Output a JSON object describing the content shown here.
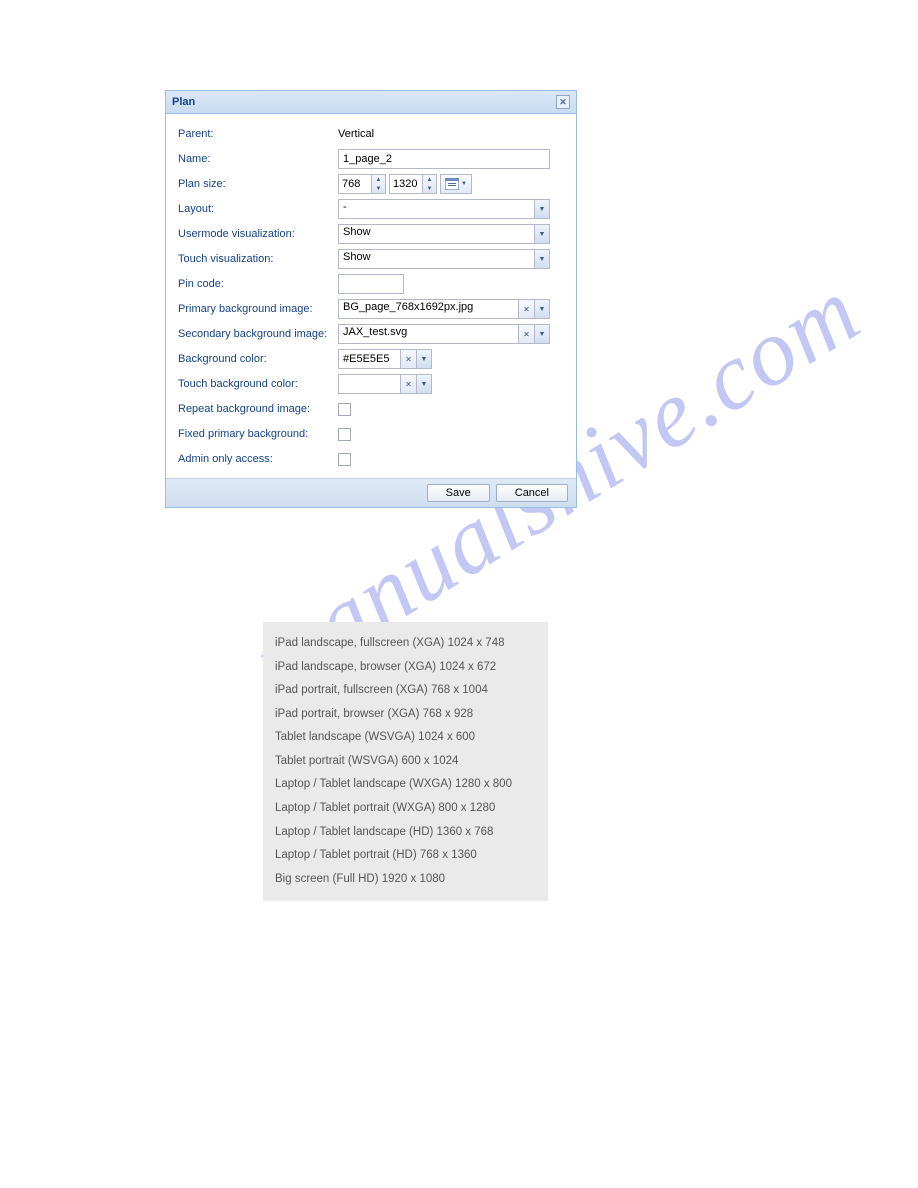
{
  "watermark": "manualshive.com",
  "dialog": {
    "title": "Plan",
    "labels": {
      "parent": "Parent:",
      "name": "Name:",
      "plan_size": "Plan size:",
      "layout": "Layout:",
      "usermode": "Usermode visualization:",
      "touch": "Touch visualization:",
      "pin": "Pin code:",
      "primary_bg": "Primary background image:",
      "secondary_bg": "Secondary background image:",
      "bg_color": "Background color:",
      "touch_bg_color": "Touch background color:",
      "repeat_bg": "Repeat background image:",
      "fixed_bg": "Fixed primary background:",
      "admin_only": "Admin only access:"
    },
    "values": {
      "parent": "Vertical",
      "name": "1_page_2",
      "size_w": "768",
      "size_h": "1320",
      "layout": "-",
      "usermode": "Show",
      "touch": "Show",
      "pin": "",
      "primary_bg": "BG_page_768x1692px.jpg",
      "secondary_bg": "JAX_test.svg",
      "bg_color": "#E5E5E5",
      "touch_bg_color": ""
    },
    "buttons": {
      "save": "Save",
      "cancel": "Cancel"
    }
  },
  "size_list": [
    "iPad landscape, fullscreen (XGA) 1024 x 748",
    "iPad landscape, browser (XGA) 1024 x 672",
    "iPad portrait, fullscreen (XGA) 768 x 1004",
    "iPad portrait, browser (XGA) 768 x 928",
    "Tablet landscape (WSVGA) 1024 x 600",
    "Tablet portrait (WSVGA) 600 x 1024",
    "Laptop / Tablet landscape (WXGA) 1280 x 800",
    "Laptop / Tablet portrait (WXGA) 800 x 1280",
    "Laptop / Tablet landscape (HD) 1360 x 768",
    "Laptop / Tablet portrait (HD) 768 x 1360",
    "Big screen (Full HD) 1920 x 1080"
  ]
}
